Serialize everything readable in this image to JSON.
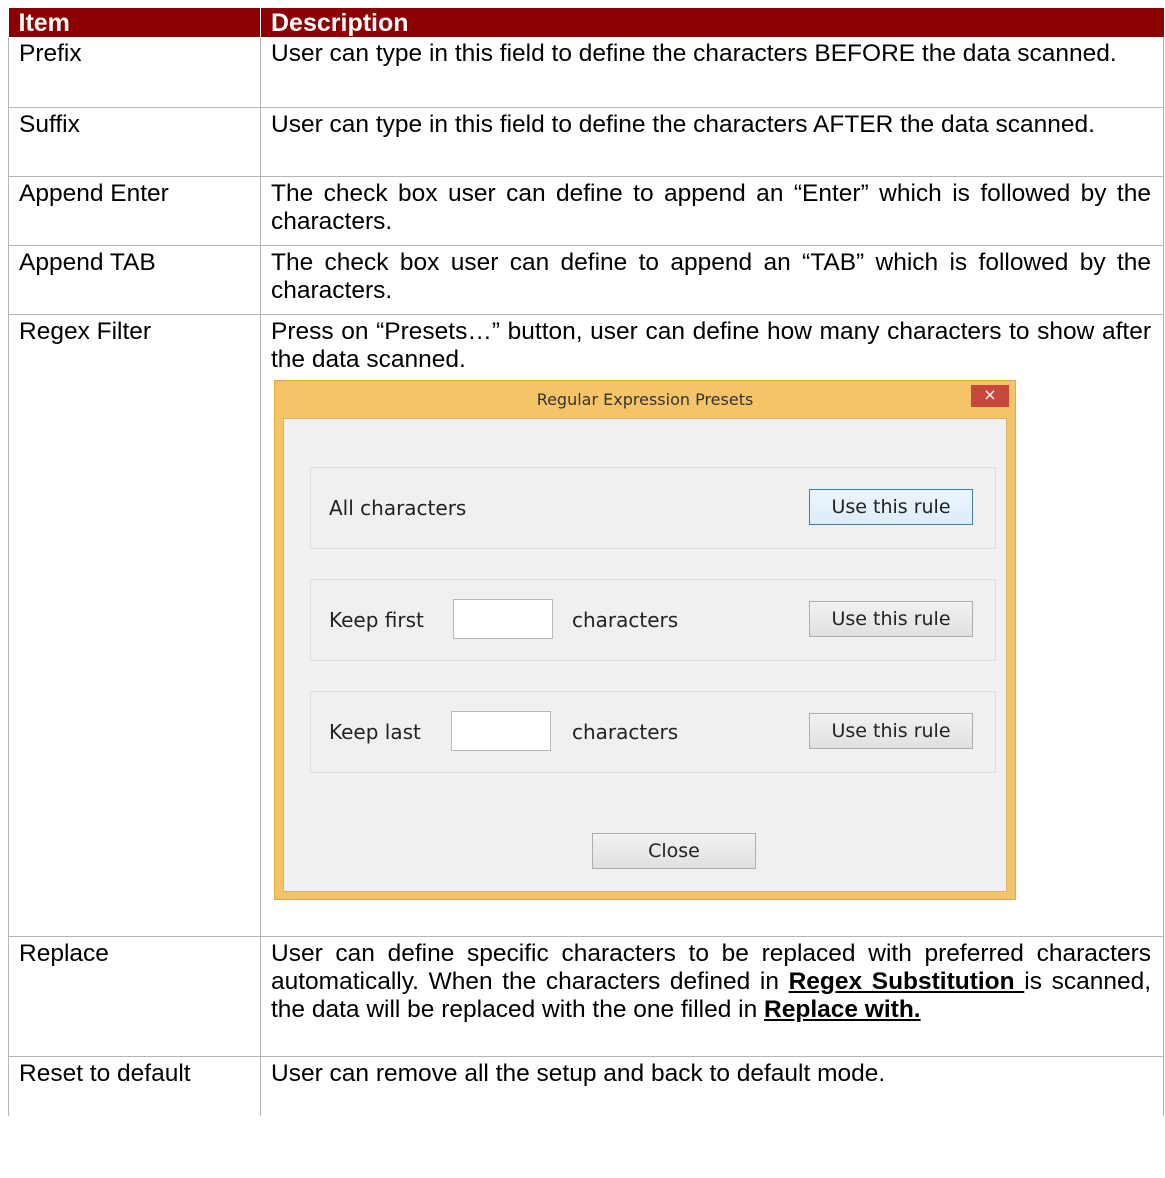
{
  "table": {
    "headers": [
      "Item",
      "Description"
    ],
    "rows": [
      {
        "item": "Prefix",
        "desc": "User can type in this field to define the characters BEFORE the data scanned."
      },
      {
        "item": "Suffix",
        "desc": "User can type in this field to define the characters AFTER the data scanned."
      },
      {
        "item": "Append Enter",
        "desc": "The check box user can define to append an “Enter” which is followed by the characters."
      },
      {
        "item": "Append TAB",
        "desc": "The check box user can define to append an “TAB” which is followed by the characters."
      },
      {
        "item": "Regex Filter",
        "desc": "Press on “Presets…” button, user can define how many characters to show after the data scanned."
      },
      {
        "item": "Replace",
        "desc_part1": "User can define specific characters to be replaced with preferred characters automatically. When the characters defined in ",
        "desc_bold1": "Regex Substitution ",
        "desc_part2": "is scanned, the data will be replaced with the one filled in ",
        "desc_bold2": "Replace with."
      },
      {
        "item": "Reset to default",
        "desc": "User can remove all the setup and back to default mode."
      }
    ]
  },
  "dialog": {
    "title": "Regular Expression Presets",
    "close_glyph": "×",
    "rules": [
      {
        "label": "All characters",
        "button": "Use this rule"
      },
      {
        "label": "Keep first",
        "suffix": "characters",
        "button": "Use this rule"
      },
      {
        "label": "Keep last",
        "suffix": "characters",
        "button": "Use this rule"
      }
    ],
    "close_button": "Close"
  }
}
